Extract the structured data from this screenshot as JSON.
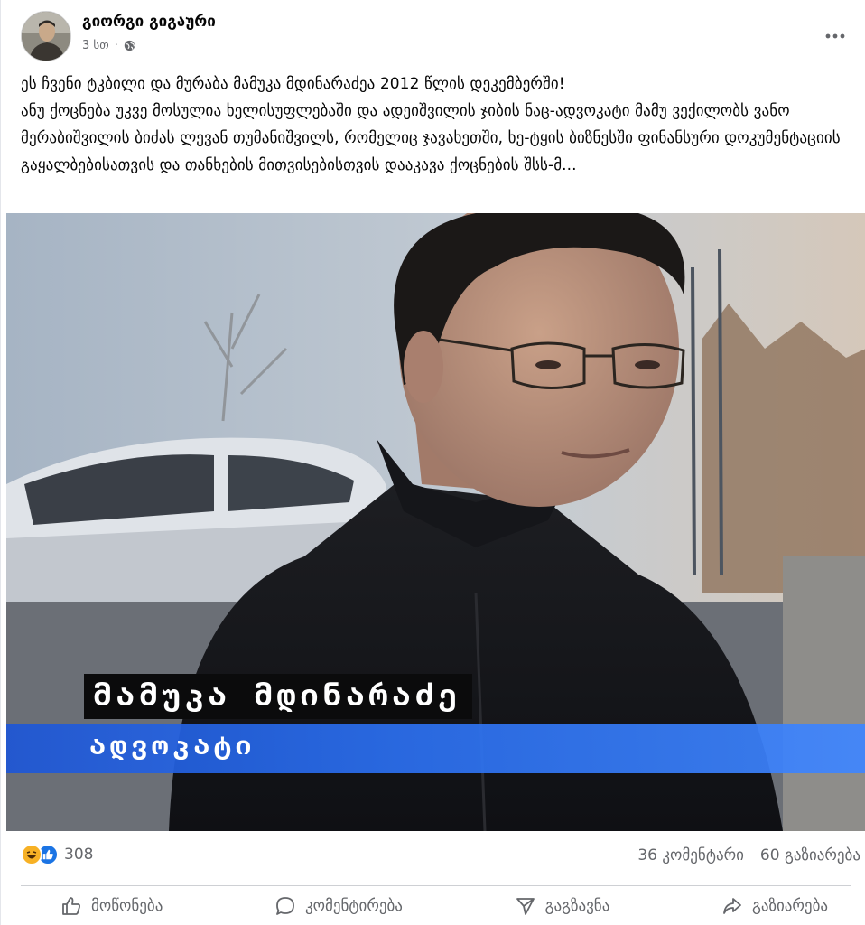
{
  "post": {
    "author": "გიორგი გიგაური",
    "time": "3 სთ",
    "time_separator": "·",
    "privacy_icon": "globe-icon",
    "caption": "ეს ჩვენი ტკბილი და მურაბა მამუკა მდინარაძეა 2012 წლის დეკემბერში!\nანუ ქოცნება უკვე მოსულია ხელისუფლებაში და ადეიშვილის ჯიბის ნაც-ადვოკატი მამუ ვექილობს ვანო მერაბიშვილის ბიძას ლევან თუმანიშვილს, რომელიც ჯავახეთში, ხე-ტყის ბიზნესში ფინანსური დოკუმენტაციის გაყალბებისათვის და თანხების მითვისებისთვის დააკავა ქოცნების შსს-მ..."
  },
  "media": {
    "lower_third_name": "მამუკა მდინარაძე",
    "lower_third_title": "ადვოკატი"
  },
  "stats": {
    "reaction_icons": [
      "haha-icon",
      "like-icon"
    ],
    "reaction_count": "308",
    "comments": "36 კომენტარი",
    "shares": "60 გაზიარება"
  },
  "actions": {
    "like": "მოწონება",
    "comment": "კომენტირება",
    "send": "გაგზავნა",
    "share": "გაზიარება"
  },
  "colors": {
    "accent": "#1b74e4",
    "secondary_text": "#65676b",
    "divider": "#ced0d4",
    "lower_third_blue": "#2b6ff0"
  }
}
